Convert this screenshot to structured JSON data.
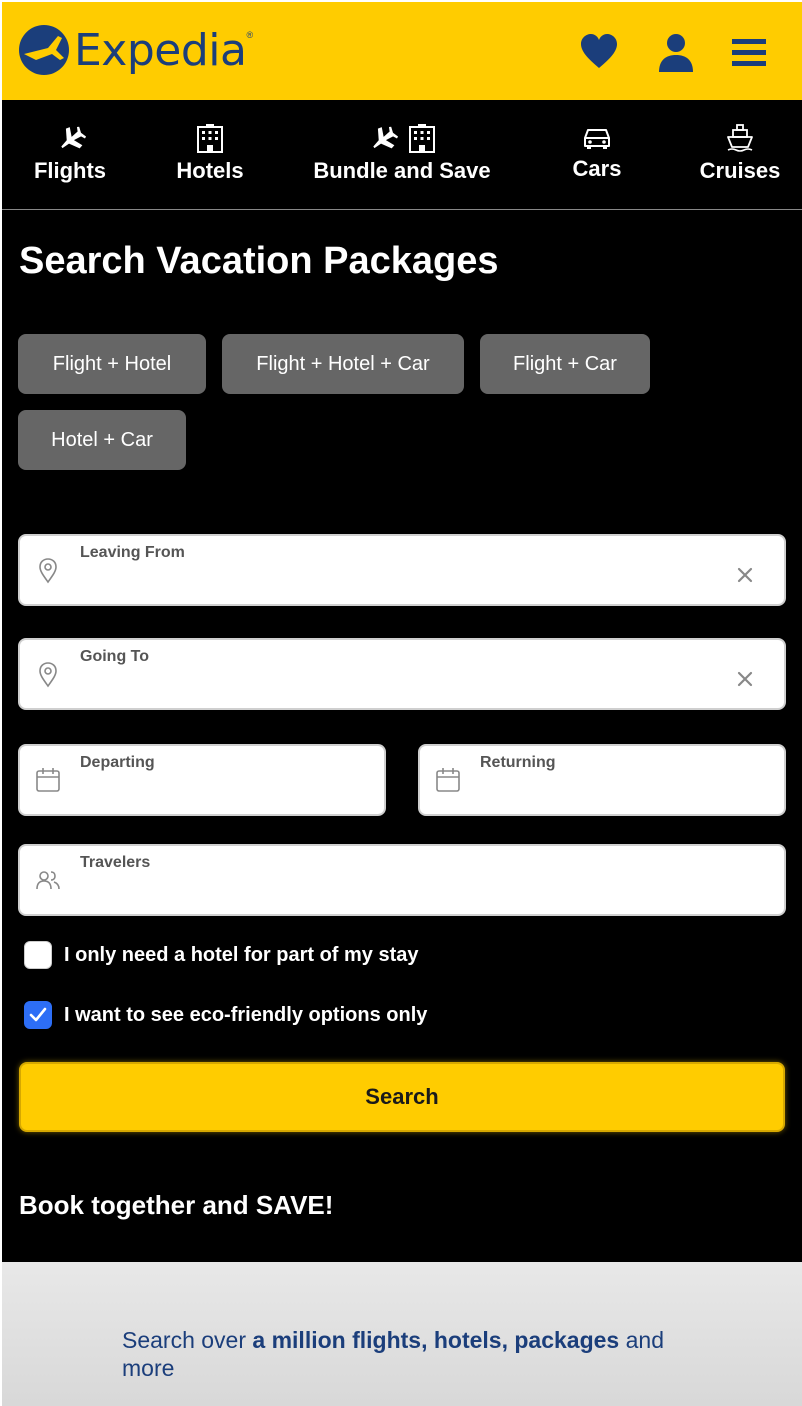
{
  "header": {
    "brand": "Expedia",
    "trademark": "®",
    "icons": [
      "heart-icon",
      "user-icon",
      "menu-icon"
    ]
  },
  "nav": {
    "items": [
      {
        "label": "Flights",
        "icons": [
          "plane-icon"
        ]
      },
      {
        "label": "Hotels",
        "icons": [
          "hotel-icon"
        ]
      },
      {
        "label": "Bundle and Save",
        "icons": [
          "plane-icon",
          "hotel-icon"
        ],
        "active": true
      },
      {
        "label": "Cars",
        "icons": [
          "car-icon"
        ]
      },
      {
        "label": "Cruises",
        "icons": [
          "ship-icon"
        ]
      }
    ]
  },
  "main": {
    "title": "Search Vacation Packages",
    "package_types": [
      "Flight + Hotel",
      "Flight + Hotel + Car",
      "Flight + Car",
      "Hotel + Car"
    ],
    "fields": {
      "leaving_from": {
        "label": "Leaving From",
        "value": ""
      },
      "going_to": {
        "label": "Going To",
        "value": ""
      },
      "departing": {
        "label": "Departing",
        "value": ""
      },
      "returning": {
        "label": "Returning",
        "value": ""
      },
      "travelers": {
        "label": "Travelers",
        "value": ""
      }
    },
    "options": [
      {
        "label": "I only need a hotel for part of my stay",
        "checked": false
      },
      {
        "label": "I want to see eco-friendly options only",
        "checked": true
      }
    ],
    "search_label": "Search",
    "book_together": "Book together and SAVE!"
  },
  "promo": {
    "prefix": "Search over ",
    "highlight": "a million flights, hotels, packages",
    "suffix": " and more"
  },
  "colors": {
    "brand_yellow": "#ffcc00",
    "brand_navy": "#1b3e7b",
    "chip_gray": "#666666",
    "check_blue": "#2d6ef6"
  }
}
